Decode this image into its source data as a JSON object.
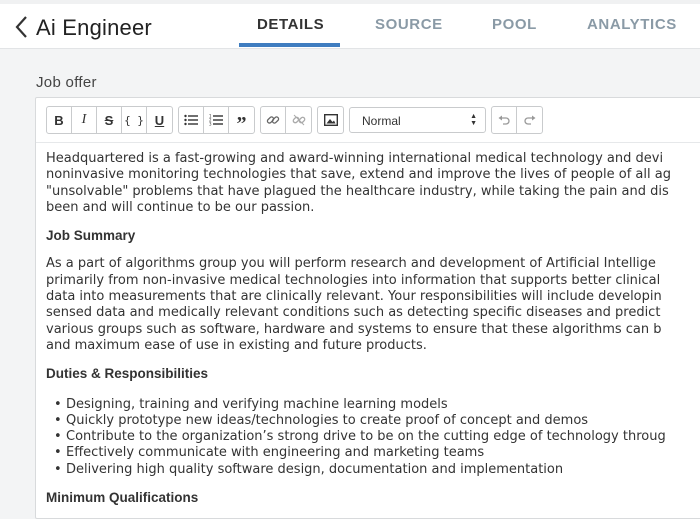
{
  "header": {
    "title": "Ai Engineer",
    "tabs": [
      {
        "label": "DETAILS",
        "active": true
      },
      {
        "label": "SOURCE",
        "active": false
      },
      {
        "label": "POOL",
        "active": false
      },
      {
        "label": "ANALYTICS",
        "active": false
      }
    ]
  },
  "section": {
    "label": "Job offer"
  },
  "toolbar": {
    "format_select": "Normal",
    "icons": [
      "bold-icon",
      "italic-icon",
      "strikethrough-icon",
      "code-icon",
      "underline-icon",
      "bullet-list-icon",
      "numbered-list-icon",
      "blockquote-icon",
      "link-icon",
      "unlink-icon",
      "image-icon",
      "undo-icon",
      "redo-icon"
    ]
  },
  "content": {
    "intro": [
      "Headquartered is a fast-growing and award-winning international medical technology and devi",
      "noninvasive monitoring technologies that save, extend and improve the lives of people of all ag",
      "\"unsolvable\" problems that have plagued the healthcare industry, while taking the pain and dis",
      "been and will continue to be our passion."
    ],
    "summary_heading": "Job Summary",
    "summary": [
      "As a part of algorithms group you will perform research and development of Artificial Intellige",
      "primarily from non-invasive medical technologies into information that supports better clinical",
      "data into measurements that are clinically relevant. Your responsibilities will include developin",
      "sensed data and medically relevant conditions such as detecting specific diseases and predict",
      "various groups such as software, hardware and systems to ensure that these algorithms can b",
      "and maximum ease of use in existing and future products."
    ],
    "duties_heading": "Duties & Responsibilities",
    "duties": [
      "Designing, training and verifying machine learning models",
      "Quickly prototype new ideas/technologies to create proof of concept and demos",
      "Contribute to the organization’s strong drive to be on the cutting edge of technology throug",
      "Effectively communicate with engineering and marketing teams",
      "Delivering high quality software design, documentation and implementation"
    ],
    "next_heading": "Minimum Qualifications"
  }
}
